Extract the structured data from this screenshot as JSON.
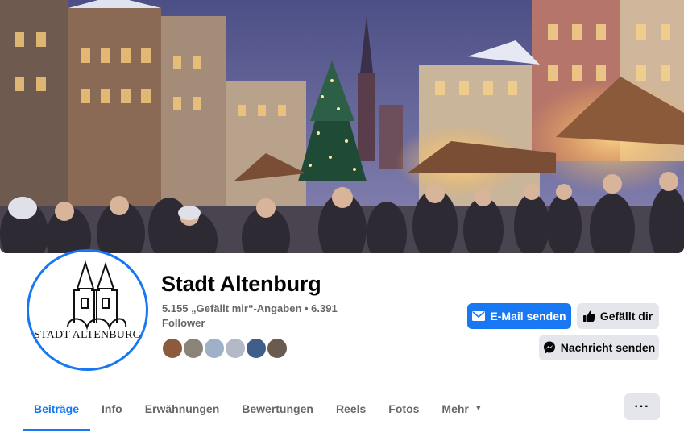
{
  "page": {
    "name": "Stadt Altenburg",
    "likes_line": "5.155 „Gefällt mir“-Angaben • 6.391",
    "followers_line": "Follower",
    "logo_text": "STADT ALTENBURG"
  },
  "actions": {
    "email_label": "E-Mail senden",
    "like_label": "Gefällt dir",
    "message_label": "Nachricht senden"
  },
  "tabs": [
    {
      "label": "Beiträge",
      "active": true
    },
    {
      "label": "Info"
    },
    {
      "label": "Erwähnungen"
    },
    {
      "label": "Bewertungen"
    },
    {
      "label": "Reels"
    },
    {
      "label": "Fotos"
    },
    {
      "label": "Mehr"
    }
  ],
  "more_menu_label": "···",
  "colors": {
    "accent": "#1877f2",
    "secondary_button": "#e4e6eb",
    "muted_text": "#65676b"
  },
  "icons": [
    "mail-icon",
    "thumbs-up-icon",
    "messenger-icon",
    "caret-down-icon",
    "ellipsis-icon"
  ]
}
